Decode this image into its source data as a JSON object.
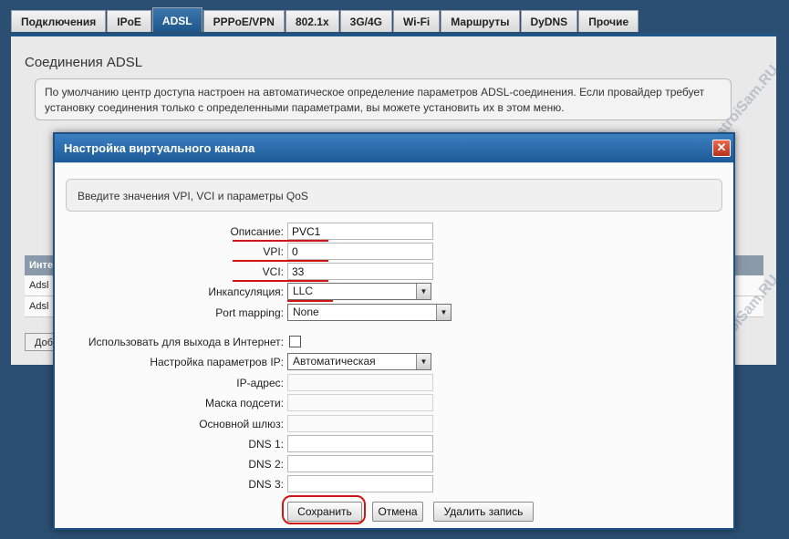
{
  "tabs": [
    "Подключения",
    "IPoE",
    "ADSL",
    "PPPoE/VPN",
    "802.1x",
    "3G/4G",
    "Wi-Fi",
    "Маршруты",
    "DyDNS",
    "Прочие"
  ],
  "page": {
    "title": "Соединения ADSL",
    "info": "По умолчанию центр доступа настроен на автоматическое определение параметров ADSL-соединения. Если провайдер требует установку соединения только с определенными параметрами, вы можете установить их в этом меню.",
    "table_header": "Инте",
    "row1": "Adsl",
    "row2": "Adsl",
    "add_button": "Доб"
  },
  "watermark": "NastroiSam.RU",
  "dialog": {
    "title": "Настройка виртуального канала",
    "hint": "Введите значения VPI, VCI и параметры QoS",
    "fields": {
      "description_label": "Описание:",
      "description_value": "PVC1",
      "vpi_label": "VPI:",
      "vpi_value": "0",
      "vci_label": "VCI:",
      "vci_value": "33",
      "encap_label": "Инкапсуляция:",
      "encap_value": "LLC",
      "port_mapping_label": "Port mapping:",
      "port_mapping_value": "None",
      "internet_label": "Использовать для выхода в Интернет:",
      "ip_settings_label": "Настройка параметров IP:",
      "ip_settings_value": "Автоматическая",
      "ip_label": "IP-адрес:",
      "mask_label": "Маска подсети:",
      "gateway_label": "Основной шлюз:",
      "dns1_label": "DNS 1:",
      "dns2_label": "DNS 2:",
      "dns3_label": "DNS 3:"
    },
    "buttons": {
      "save": "Сохранить",
      "cancel": "Отмена",
      "delete": "Удалить запись"
    },
    "close_glyph": "✕"
  },
  "colors": {
    "accent": "#1f568a",
    "highlight": "#d21414"
  }
}
